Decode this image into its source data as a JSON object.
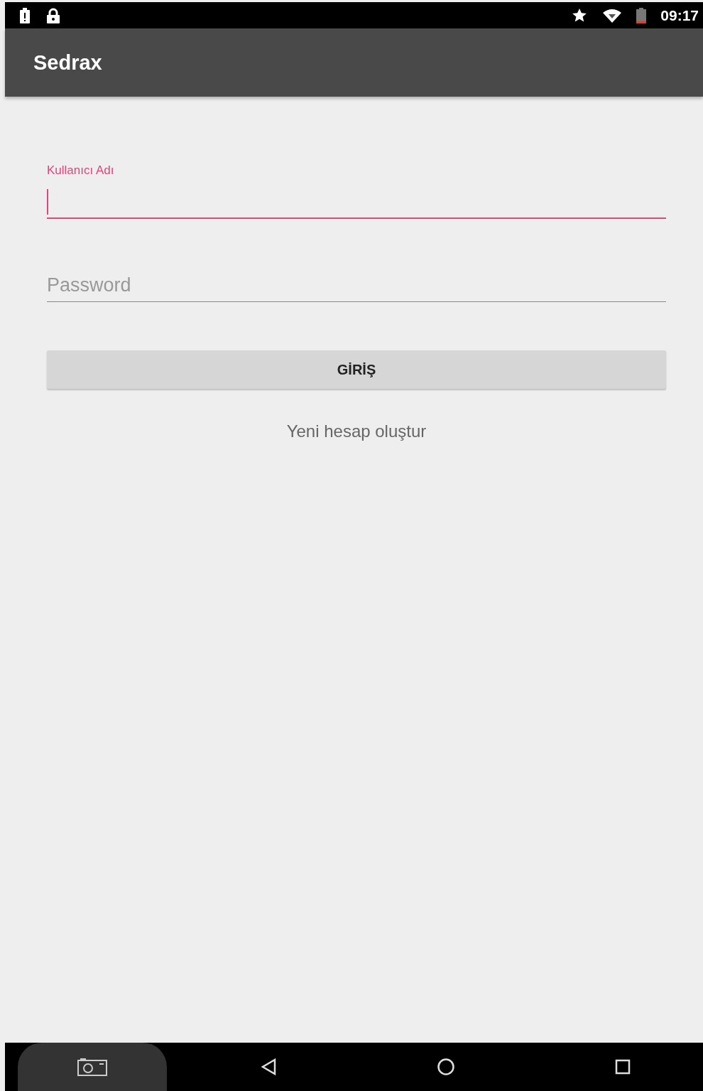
{
  "status_bar": {
    "time": "09:17"
  },
  "app_bar": {
    "title": "Sedrax"
  },
  "fields": [
    {
      "label": "Kullanıcı Adı",
      "focused": true
    },
    {
      "placeholder": "Password",
      "focused": false
    }
  ],
  "login_button": {
    "label": "GİRİŞ"
  },
  "register_link": {
    "label": "Yeni hesap oluştur"
  }
}
